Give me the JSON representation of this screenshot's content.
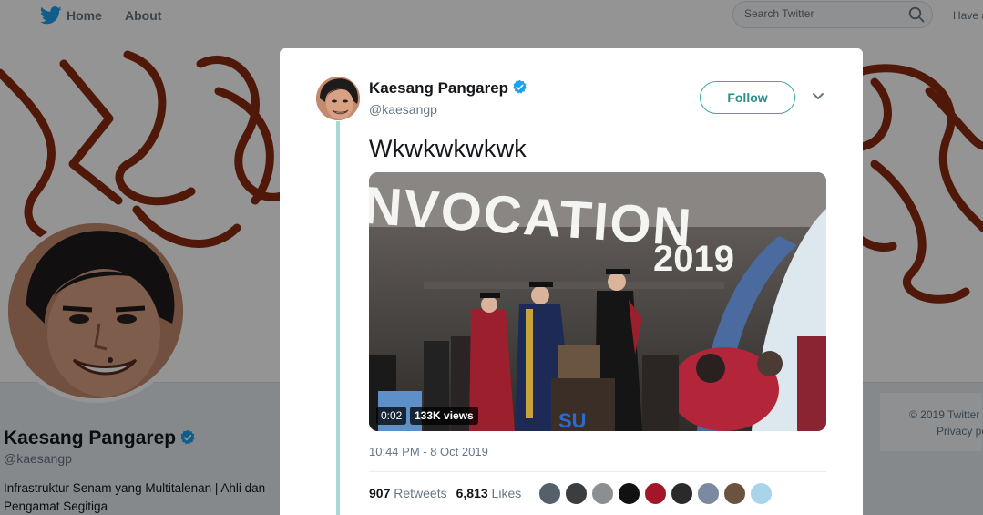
{
  "nav": {
    "home_label": "Home",
    "about_label": "About",
    "search_placeholder": "Search Twitter",
    "account_text": "Have a"
  },
  "profile": {
    "name": "Kaesang Pangarep",
    "handle": "@kaesangp",
    "bio": "Infrastruktur Senam yang Multitalenan | Ahli dan Pengamat Segitiga"
  },
  "footer": {
    "copyright": "© 2019 Twitter",
    "privacy": "Privacy po"
  },
  "tweet": {
    "author_name": "Kaesang Pangarep",
    "author_handle": "@kaesangp",
    "follow_label": "Follow",
    "text": "Wkwkwkwkwk",
    "video_time": "0:02",
    "video_views": "133K views",
    "timestamp": "10:44 PM - 8 Oct 2019",
    "retweets_count": "907",
    "retweets_label": "Retweets",
    "likes_count": "6,813",
    "likes_label": "Likes"
  },
  "colors": {
    "accent": "#2a8f89",
    "thread_line": "#a5d9d6",
    "verified": "#1da1f2",
    "banner_stroke": "#8b2a10"
  }
}
